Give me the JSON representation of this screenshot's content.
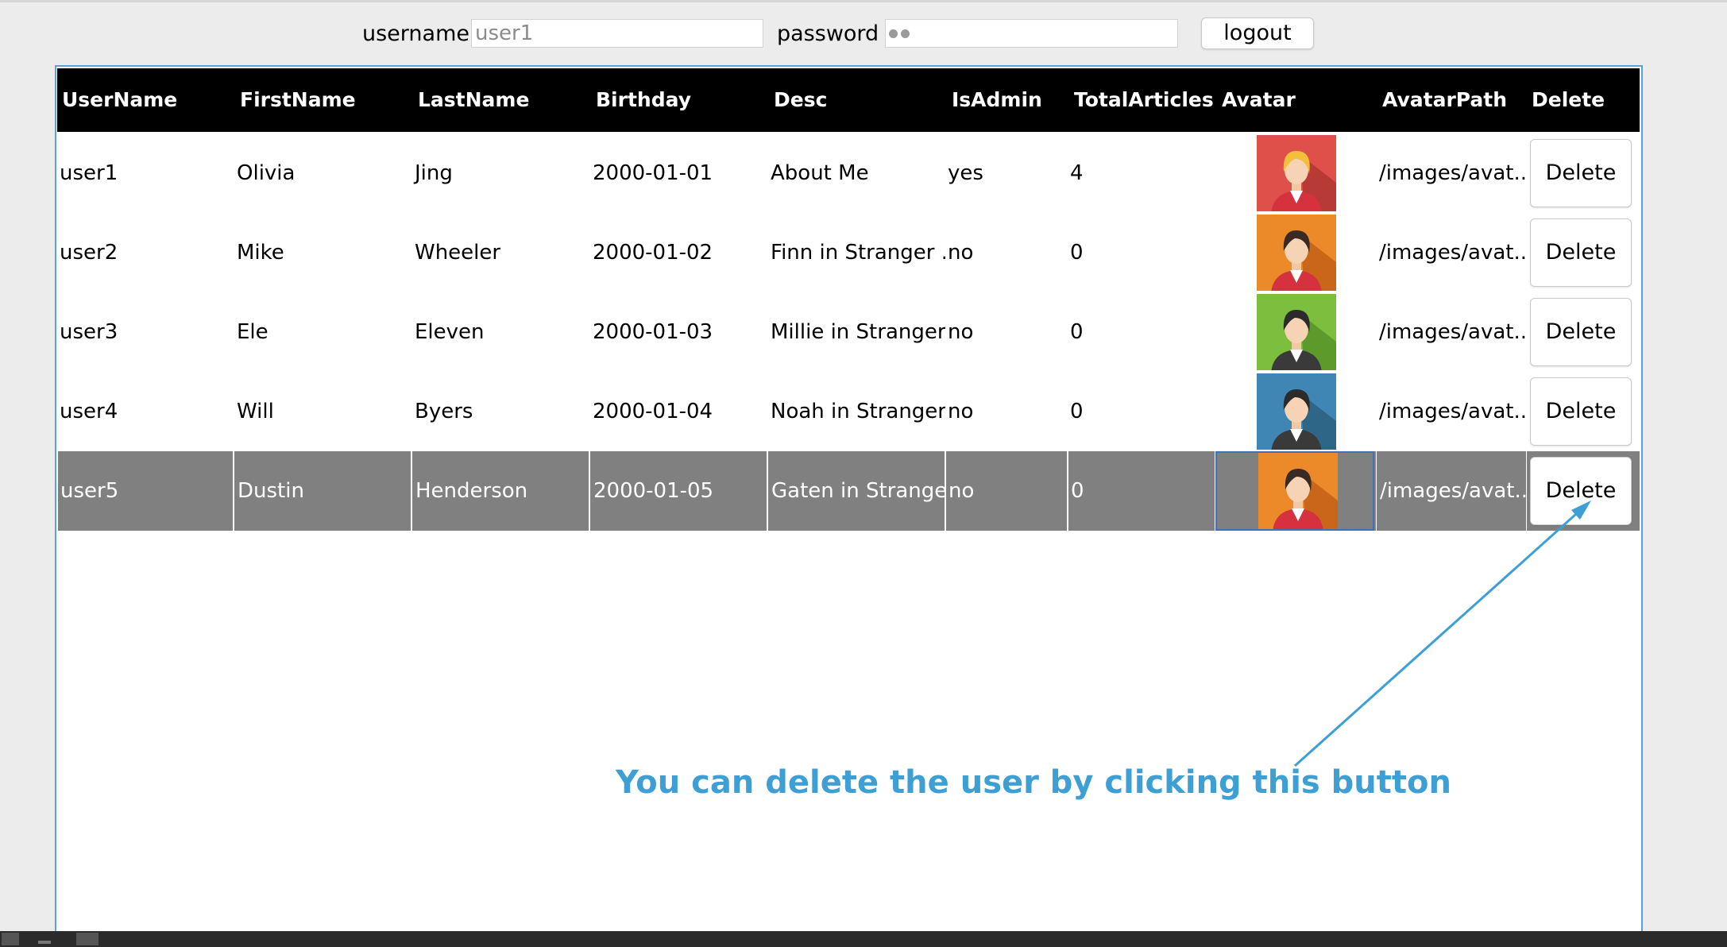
{
  "login": {
    "username_label": "username",
    "username_value": "user1",
    "password_label": "password",
    "password_dots": 2,
    "logout_label": "logout"
  },
  "table": {
    "columns": [
      "UserName",
      "FirstName",
      "LastName",
      "Birthday",
      "Desc",
      "IsAdmin",
      "TotalArticles",
      "Avatar",
      "AvatarPath",
      "Delete"
    ],
    "rows": [
      {
        "username": "user1",
        "firstname": "Olivia",
        "lastname": "Jing",
        "birthday": "2000-01-01",
        "desc": "About Me",
        "isadmin": "yes",
        "total": "4",
        "avatar": "woman-blonde-avatar",
        "path": "/images/avat...",
        "delete": "Delete"
      },
      {
        "username": "user2",
        "firstname": "Mike",
        "lastname": "Wheeler",
        "birthday": "2000-01-02",
        "desc": "Finn in Stranger ...",
        "isadmin": "no",
        "total": "0",
        "avatar": "woman-dark-hair-avatar",
        "path": "/images/avat...",
        "delete": "Delete"
      },
      {
        "username": "user3",
        "firstname": "Ele",
        "lastname": "Eleven",
        "birthday": "2000-01-03",
        "desc": "Millie in Stranger...",
        "isadmin": "no",
        "total": "0",
        "avatar": "woman-suit-avatar",
        "path": "/images/avat...",
        "delete": "Delete"
      },
      {
        "username": "user4",
        "firstname": "Will",
        "lastname": "Byers",
        "birthday": "2000-01-04",
        "desc": "Noah in Stranger...",
        "isadmin": "no",
        "total": "0",
        "avatar": "man-suit-avatar",
        "path": "/images/avat...",
        "delete": "Delete"
      },
      {
        "username": "user5",
        "firstname": "Dustin",
        "lastname": "Henderson",
        "birthday": "2000-01-05",
        "desc": "Gaten in Strange...",
        "isadmin": "no",
        "total": "0",
        "avatar": "woman-dark-hair-avatar",
        "path": "/images/avat...",
        "delete": "Delete"
      }
    ],
    "selected_row": "user5"
  },
  "annotation": {
    "text": "You can delete the user by clicking this button"
  },
  "colors": {
    "header_bg": "#000000",
    "selected_row_bg": "#808080",
    "annotation": "#3d9fd3",
    "panel_border": "#5aa3d6"
  }
}
